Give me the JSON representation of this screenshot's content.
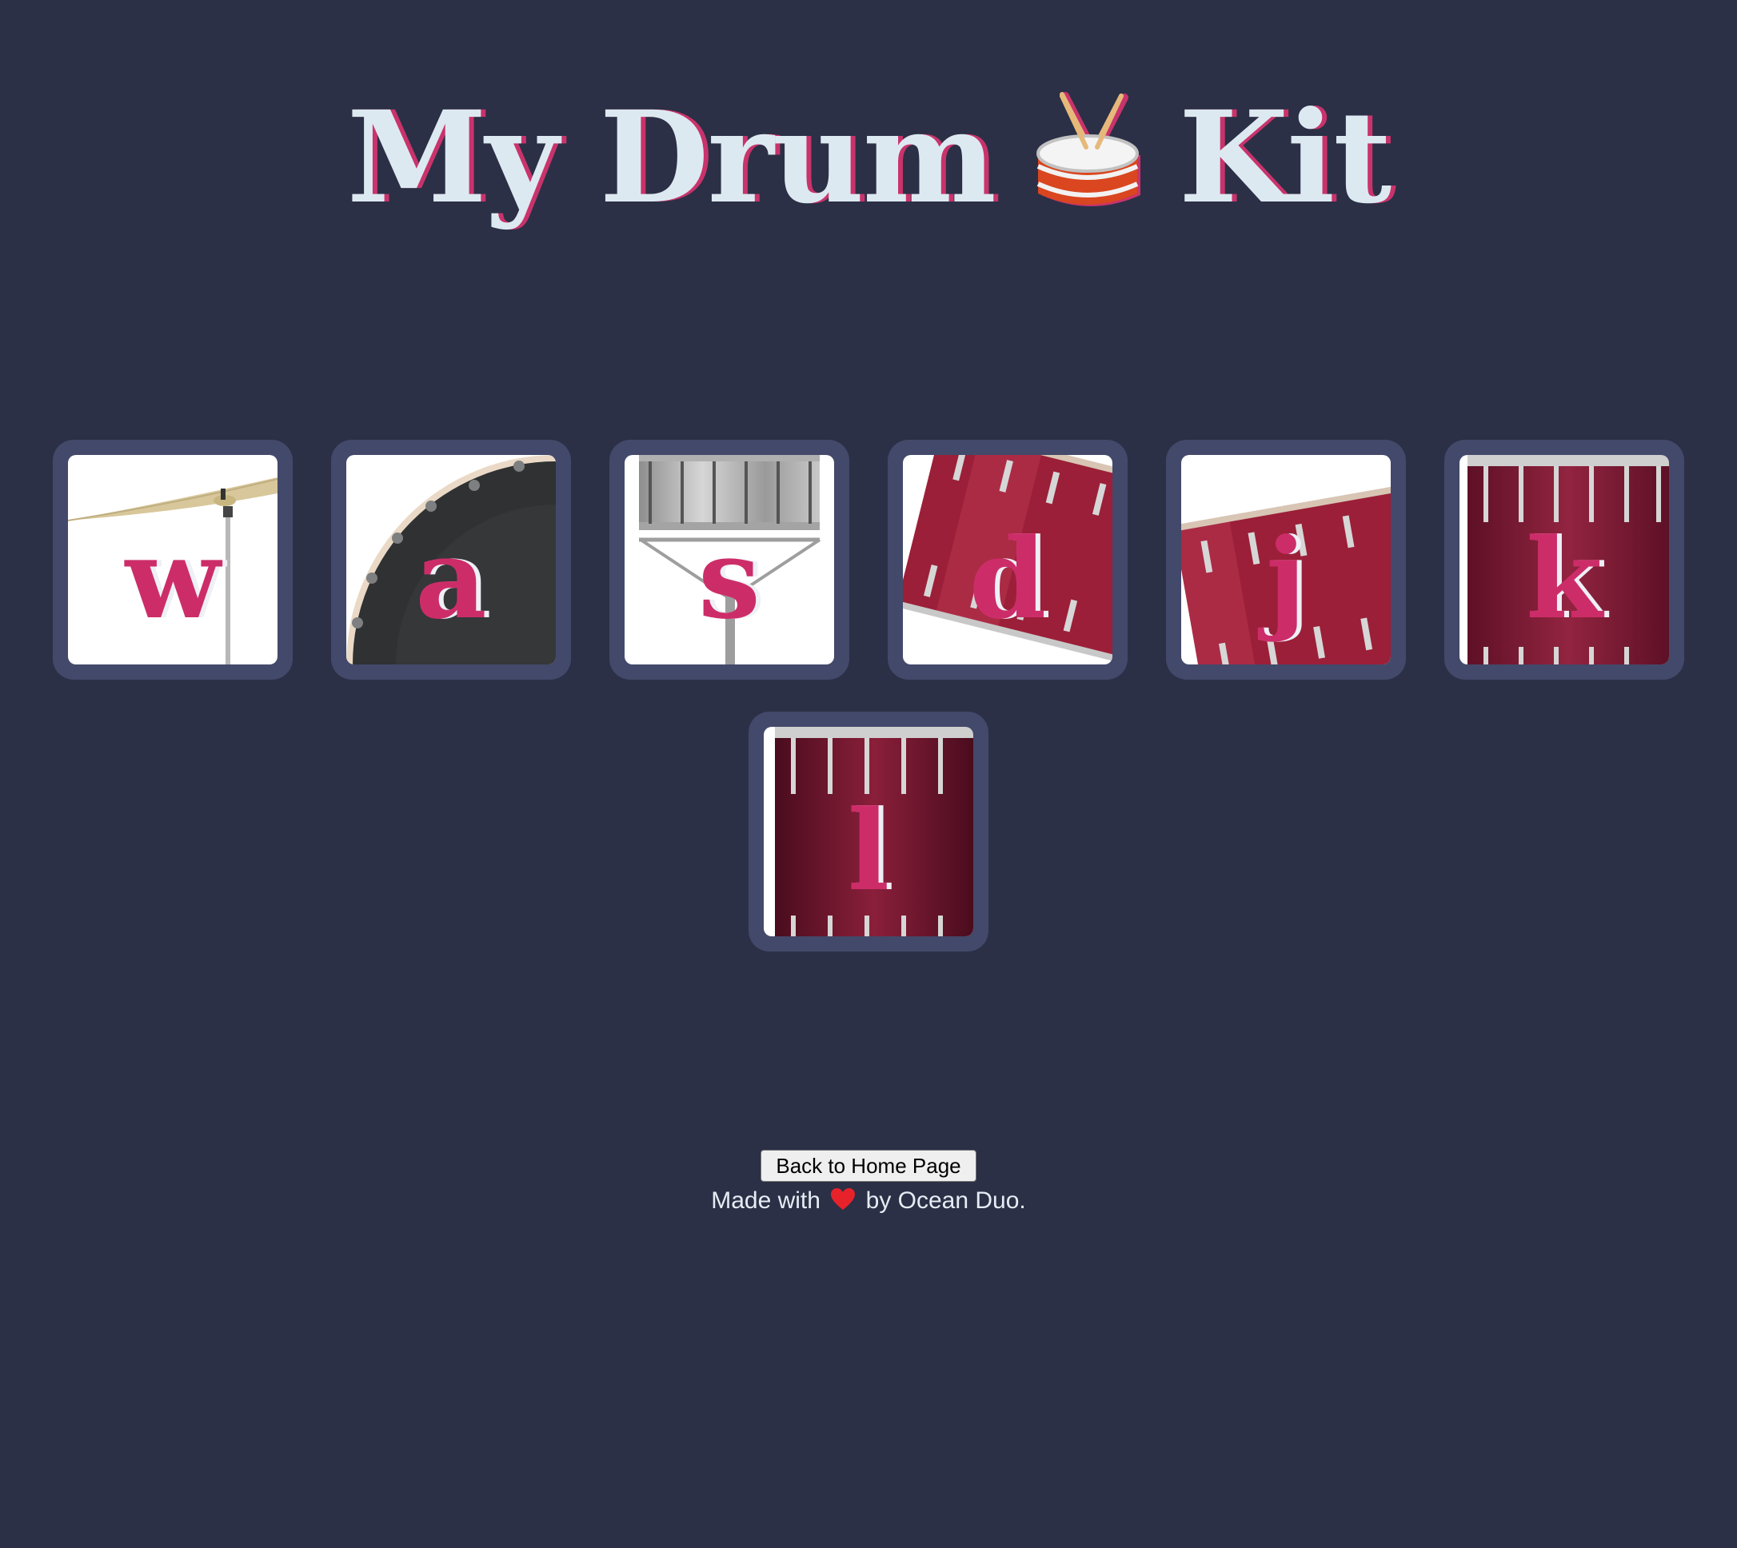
{
  "header": {
    "title_before": "My Drum",
    "title_icon": "drum-with-sticks-icon",
    "title_after": "Kit"
  },
  "pads": [
    {
      "key": "w",
      "art": "crash-cymbal"
    },
    {
      "key": "a",
      "art": "kick-bass-drum"
    },
    {
      "key": "s",
      "art": "snare-drum"
    },
    {
      "key": "d",
      "art": "tom-1"
    },
    {
      "key": "j",
      "art": "tom-2"
    },
    {
      "key": "k",
      "art": "tom-3"
    },
    {
      "key": "l",
      "art": "tom-4"
    }
  ],
  "footer": {
    "home_button_label": "Back to Home Page",
    "made_with": "Made with",
    "heart_icon": "red-heart-icon",
    "by_line": "by Ocean Duo."
  },
  "colors": {
    "background": "#2b3046",
    "pad_frame": "#43496a",
    "key_letter": "#cc2d68",
    "title_text": "#dde9f1",
    "title_shadow": "#c9336b"
  }
}
